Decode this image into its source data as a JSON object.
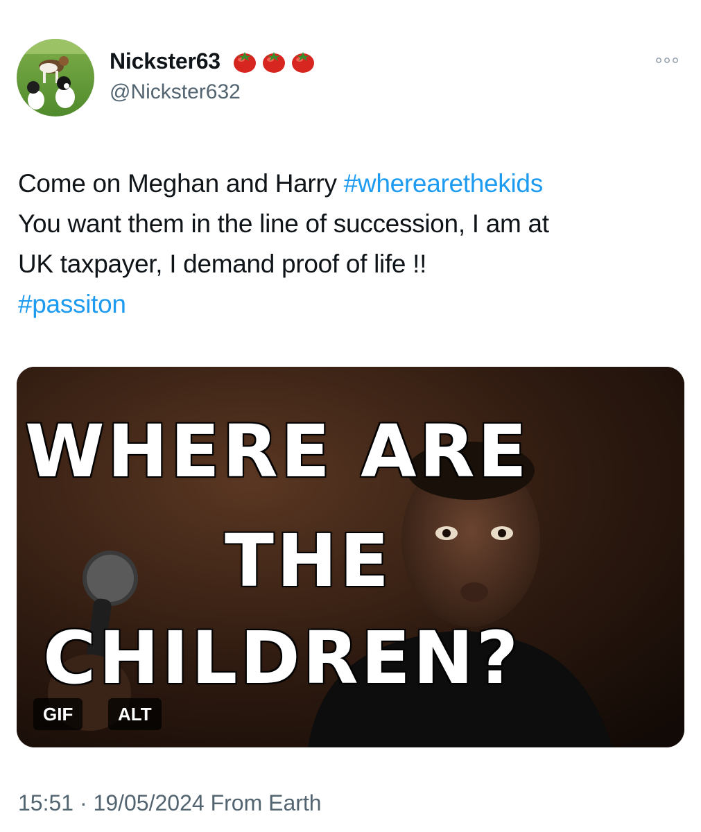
{
  "author": {
    "display_name": "Nickster63",
    "handle": "@Nickster632",
    "badges": [
      "tomato-emoji",
      "tomato-emoji",
      "tomato-emoji"
    ],
    "avatar": "avatar-two-dogs-on-grass"
  },
  "tweet": {
    "lines": [
      [
        {
          "text": "Come on Meghan and Harry ",
          "type": "text"
        },
        {
          "text": "#wherearethekids",
          "type": "hashtag"
        }
      ],
      [
        {
          "text": "You want them in the line of succession, I am at",
          "type": "text"
        }
      ],
      [
        {
          "text": "UK taxpayer, I demand proof of life !!",
          "type": "text"
        }
      ],
      [
        {
          "text": "#passiton",
          "type": "hashtag"
        }
      ]
    ]
  },
  "media": {
    "type": "gif",
    "caption_lines": [
      "WHERE ARE",
      "THE",
      "CHILDREN?"
    ],
    "gif_badge": "GIF",
    "alt_badge": "ALT"
  },
  "meta": {
    "time": "15:51",
    "separator": "·",
    "date": "19/05/2024",
    "source": "From Earth"
  },
  "colors": {
    "hashtag": "#1d9bf0",
    "secondary_text": "#536471",
    "primary_text": "#0f1419"
  },
  "icons": {
    "more": "more-horizontal-icon"
  }
}
